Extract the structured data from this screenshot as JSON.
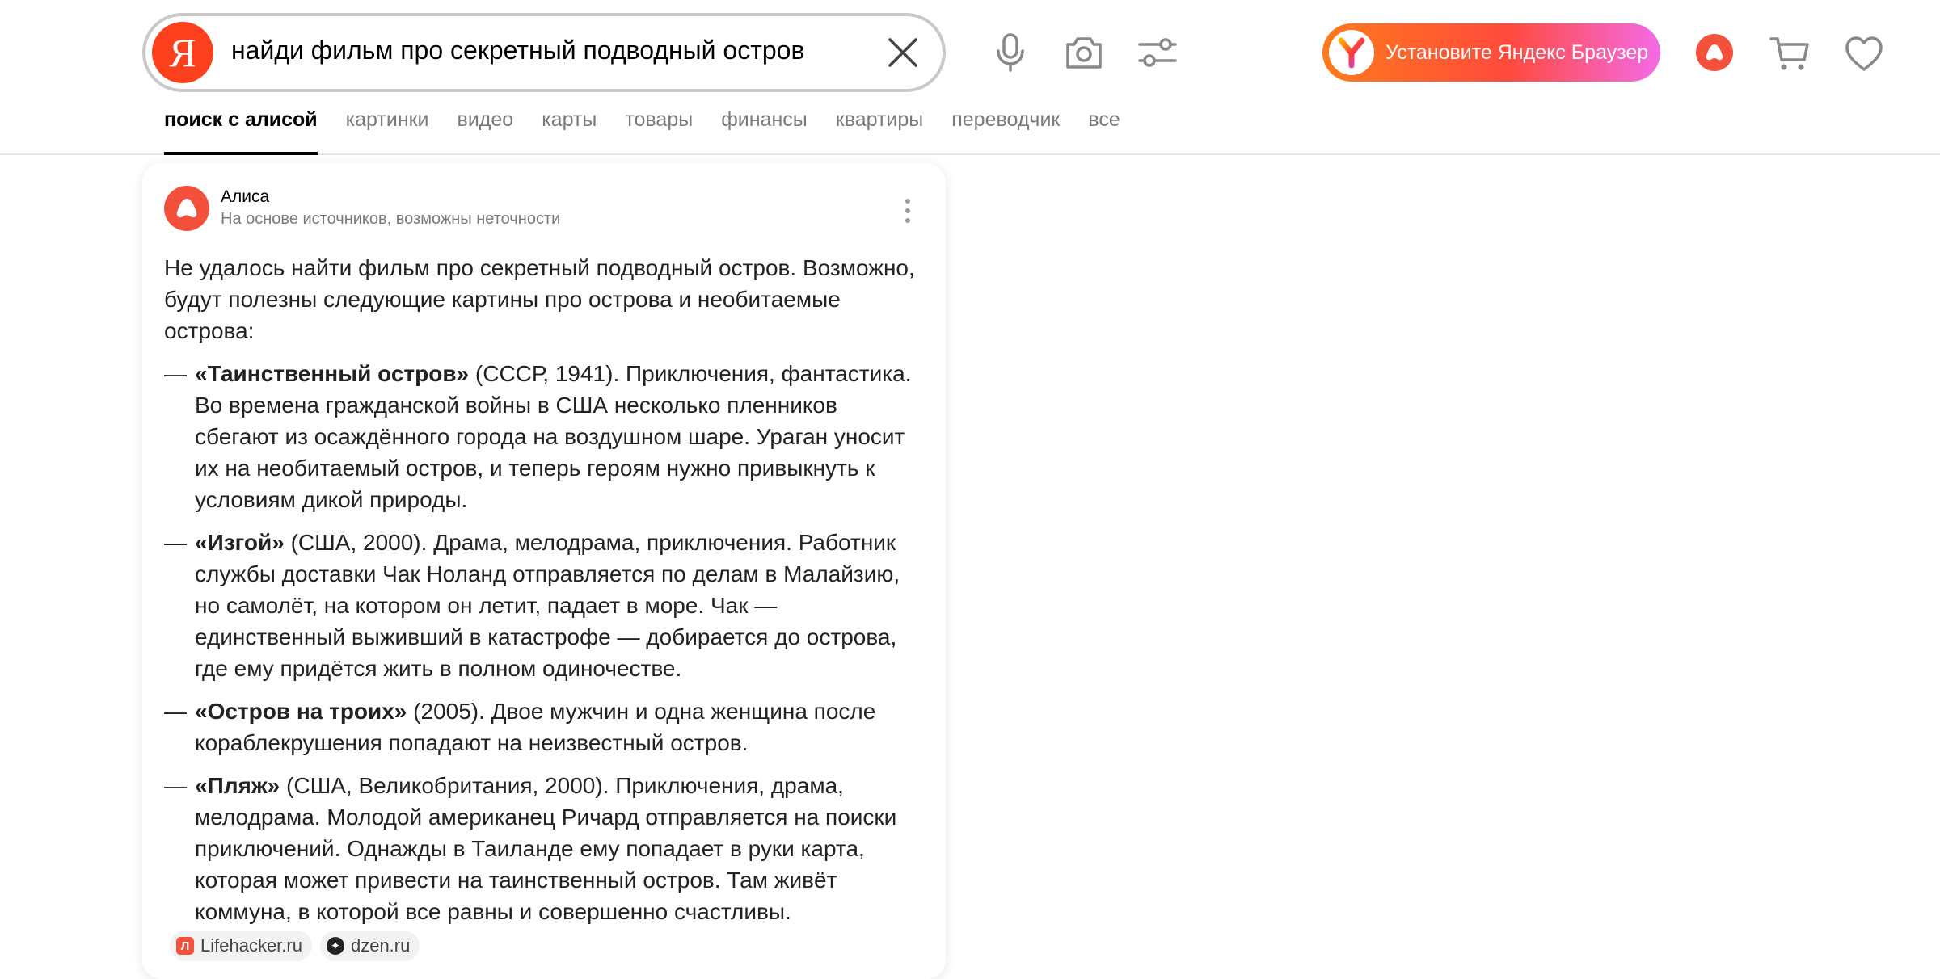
{
  "search": {
    "logo_letter": "Я",
    "query": "найди фильм про секретный подводный остров"
  },
  "promo": {
    "install_label": "Установите Яндекс Браузер"
  },
  "tabs": [
    {
      "label": "поиск с алисой",
      "active": true
    },
    {
      "label": "картинки"
    },
    {
      "label": "видео"
    },
    {
      "label": "карты"
    },
    {
      "label": "товары"
    },
    {
      "label": "финансы"
    },
    {
      "label": "квартиры"
    },
    {
      "label": "переводчик"
    },
    {
      "label": "все"
    }
  ],
  "answer": {
    "author": "Алиса",
    "disclaimer": "На основе источников, возможны неточности",
    "intro": "Не удалось найти фильм про секретный подводный остров. Возможно, будут полезны следующие картины про острова и необитаемые острова:",
    "dash": "—",
    "films": [
      {
        "title": "«Таинственный остров»",
        "text": " (СССР, 1941). Приключения, фантастика. Во времена гражданской войны в США несколько пленников сбегают из осаждённого города на воздушном шаре. Ураган уносит их на необитаемый остров, и теперь героям нужно привыкнуть к условиям дикой природы."
      },
      {
        "title": "«Изгой»",
        "text": " (США, 2000). Драма, мелодрама, приключения. Работник службы доставки Чак Ноланд отправляется по делам в Малайзию, но самолёт, на котором он летит, падает в море. Чак — единственный выживший в катастрофе — добирается до острова, где ему придётся жить в полном одиночестве."
      },
      {
        "title": "«Остров на троих»",
        "text": " (2005). Двое мужчин и одна женщина после кораблекрушения попадают на неизвестный остров."
      },
      {
        "title": "«Пляж»",
        "text": " (США, Великобритания, 2000). Приключения, драма, мелодрама. Молодой американец Ричард отправляется на поиски приключений. Однажды в Таиланде ему попадает в руки карта, которая может привести на таинственный остров. Там живёт коммуна, в которой все равны и совершенно счастливы."
      }
    ],
    "sources": [
      {
        "label": "Lifehacker.ru",
        "icon_letter": "Л",
        "color": "#f4513d"
      },
      {
        "label": "dzen.ru",
        "icon_letter": "✦",
        "color": "#222222"
      }
    ]
  },
  "colors": {
    "yandex_red": "#fc3f1d",
    "alice": "#f4513d",
    "tab_inactive": "#7a7a7a"
  }
}
